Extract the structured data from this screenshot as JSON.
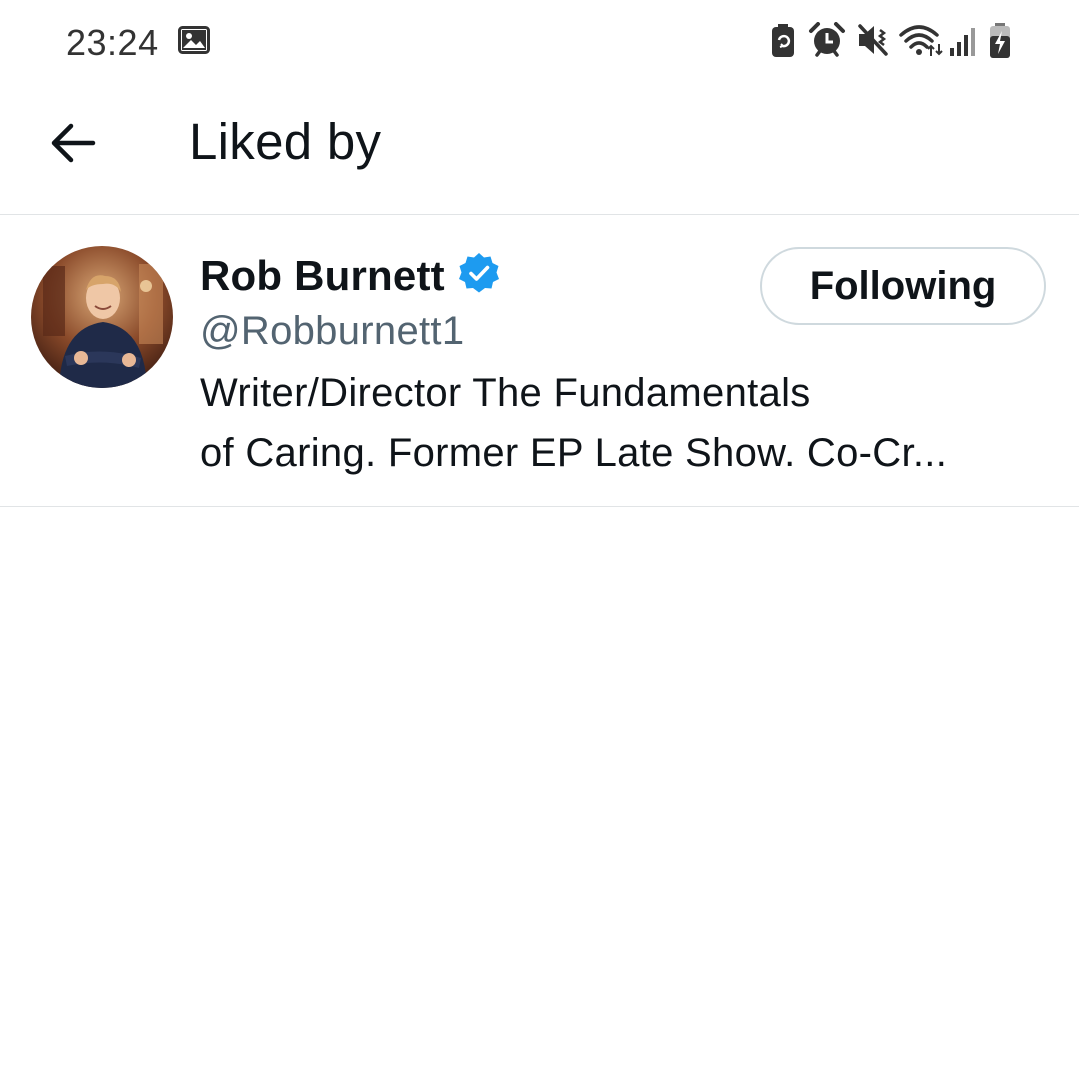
{
  "status_bar": {
    "time": "23:24",
    "icons": [
      "gallery-icon",
      "battery-saver-icon",
      "alarm-icon",
      "vibrate-icon",
      "wifi-icon",
      "signal-icon",
      "battery-charging-icon"
    ]
  },
  "header": {
    "back_icon": "arrow-left-icon",
    "title": "Liked by"
  },
  "users": [
    {
      "display_name": "Rob Burnett",
      "verified": true,
      "handle": "@Robburnett1",
      "bio_line1": "Writer/Director The Fundamentals",
      "bio_line2": "of Caring. Former EP Late Show. Co-Cr...",
      "follow_button_label": "Following"
    }
  ],
  "colors": {
    "verified_blue": "#1d9bf0",
    "text_primary": "#0f1419",
    "text_secondary": "#536471",
    "divider": "#e1e4e6",
    "button_border": "#cfd9de"
  }
}
